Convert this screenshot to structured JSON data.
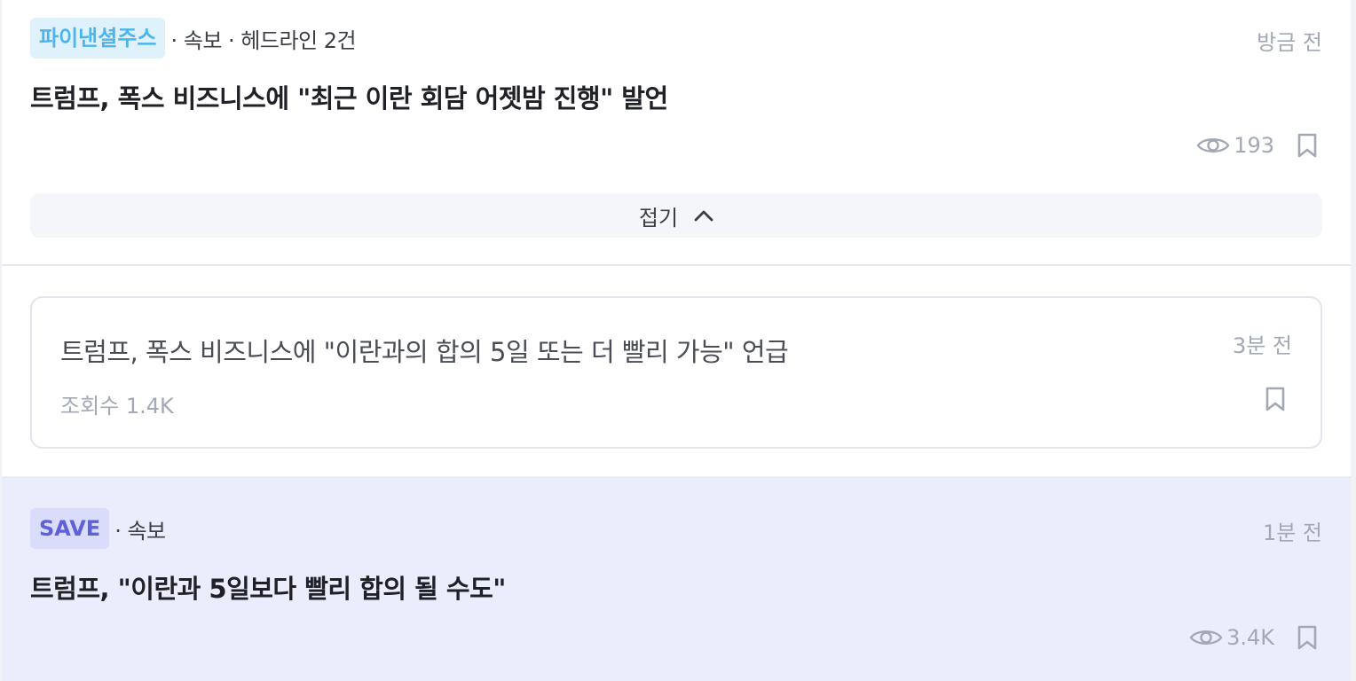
{
  "items": [
    {
      "source": "파이낸셜주스",
      "meta": "· 속보 · 헤드라인 2건",
      "time": "방금 전",
      "headline": "트럼프, 폭스 비즈니스에 \"최근 이란 회담 어젯밤 진행\" 발언",
      "views": "193",
      "collapse_label": "접기",
      "related": {
        "headline": "트럼프, 폭스 비즈니스에 \"이란과의 합의 5일 또는 더 빨리 가능\" 언급",
        "time": "3분 전",
        "views": "조회수 1.4K"
      }
    },
    {
      "source": "SAVE",
      "meta": "· 속보",
      "time": "1분 전",
      "headline": "트럼프, \"이란과 5일보다 빨리 합의 될 수도\"",
      "views": "3.4K"
    }
  ],
  "icons": {
    "views": "eye-icon",
    "bookmark": "bookmark-icon",
    "collapse": "chevron-up-icon"
  },
  "colors": {
    "badge_blue_text": "#4cb6ec",
    "badge_blue_bg": "#dff1fb",
    "badge_purple_text": "#5f61d8",
    "badge_purple_bg": "#d9dcfa",
    "highlight_bg": "#ebedfd",
    "muted_text": "#a2a8b4"
  }
}
